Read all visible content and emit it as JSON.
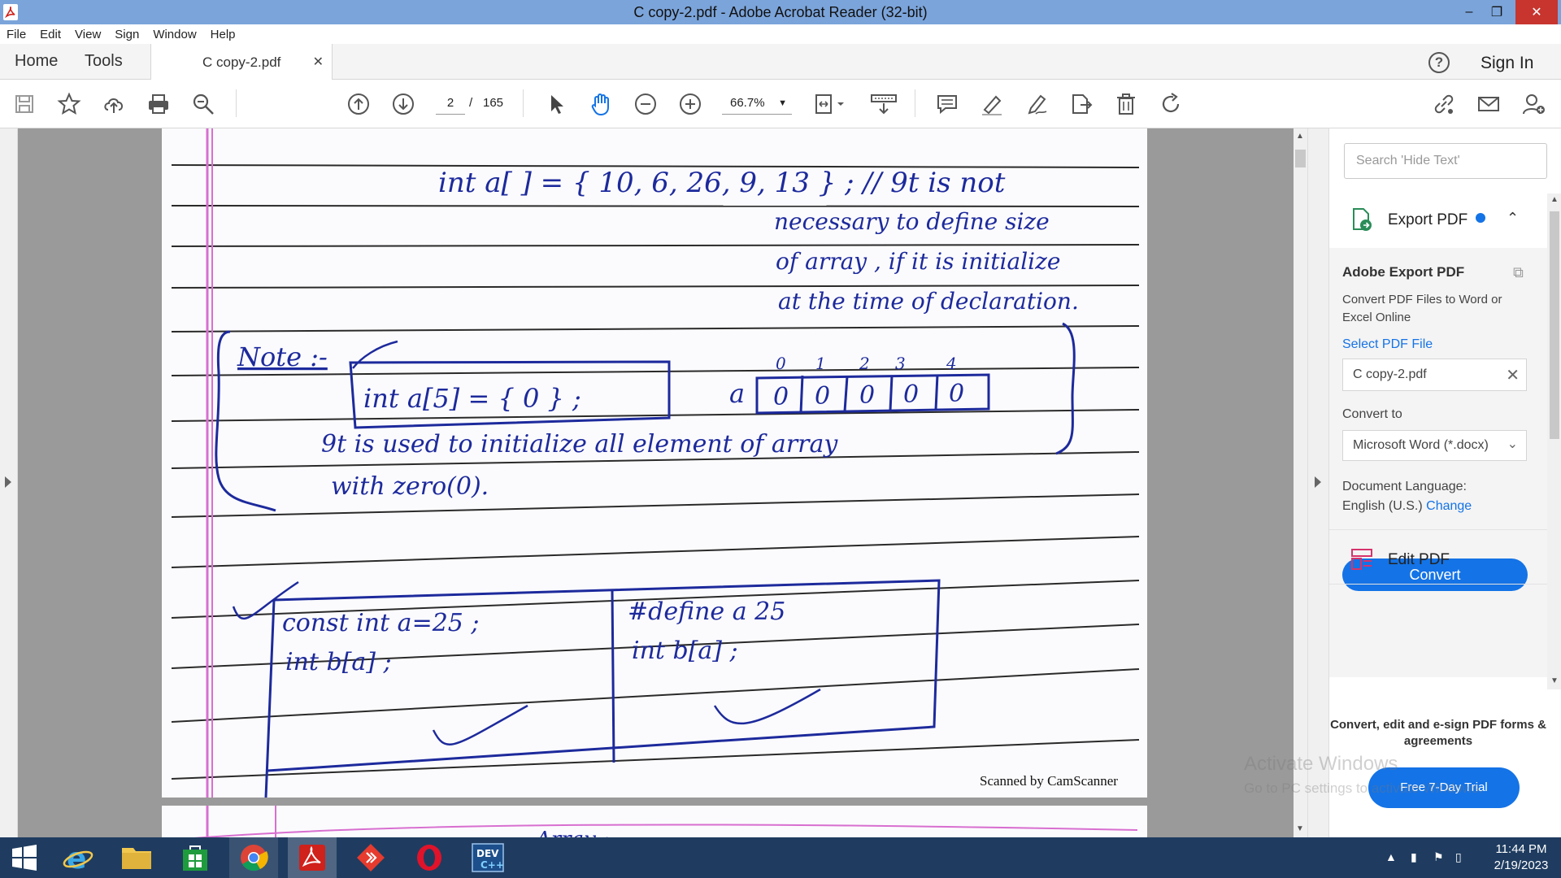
{
  "window": {
    "title": "C copy-2.pdf - Adobe Acrobat Reader (32-bit)"
  },
  "menu": [
    "File",
    "Edit",
    "View",
    "Sign",
    "Window",
    "Help"
  ],
  "tabs": {
    "home": "Home",
    "tools": "Tools",
    "document": "C copy-2.pdf",
    "sign_in": "Sign In"
  },
  "toolbar": {
    "current_page": "2",
    "page_separator": "/",
    "total_pages": "165",
    "zoom": "66.7%"
  },
  "document": {
    "lines": [
      "int   a[ ] = { 10, 6, 26, 9, 13 } ;  // 9t  is  not",
      "necessary  to  define  size",
      "of  array ,  if  it  is  initialize",
      "at  the  time  of  declaration.",
      "Note :-",
      "int   a[5] = { 0 } ;",
      "a",
      "9t  is  used  to  initialize  all  element  of  array",
      "with  zero(0).",
      "const  int   a=25 ;",
      "int   b[a] ;",
      "#define   a   25",
      "int   b[a] ;"
    ],
    "array_indices": [
      "0",
      "1",
      "2",
      "3",
      "4"
    ],
    "array_values": [
      "0",
      "0",
      "0",
      "0",
      "0"
    ],
    "footer": "Scanned by CamScanner",
    "next_page_text": "Array :-"
  },
  "right_panel": {
    "search_placeholder": "Search 'Hide Text'",
    "export_pdf": {
      "title": "Export PDF",
      "heading": "Adobe Export PDF",
      "description": "Convert PDF Files to Word or Excel Online",
      "select_file": "Select PDF File",
      "file_name": "C copy-2.pdf",
      "convert_to_label": "Convert to",
      "convert_to_value": "Microsoft Word (*.docx)",
      "language_label": "Document Language:",
      "language_value": "English (U.S.)",
      "change": "Change",
      "convert_button": "Convert"
    },
    "edit_pdf": "Edit PDF",
    "promo_text": "Convert, edit and e-sign PDF forms & agreements",
    "trial_button": "Free 7-Day Trial"
  },
  "watermark": {
    "line1": "Activate Windows",
    "line2": "Go to PC settings to activate Windows."
  },
  "taskbar": {
    "time": "11:44 PM",
    "date": "2/19/2023"
  },
  "colors": {
    "titlebar": "#7ba4da",
    "accent_blue": "#1473e6",
    "ink": "#1d2a9c",
    "margin_line": "#d86fd0",
    "taskbar": "#1f3c60"
  }
}
